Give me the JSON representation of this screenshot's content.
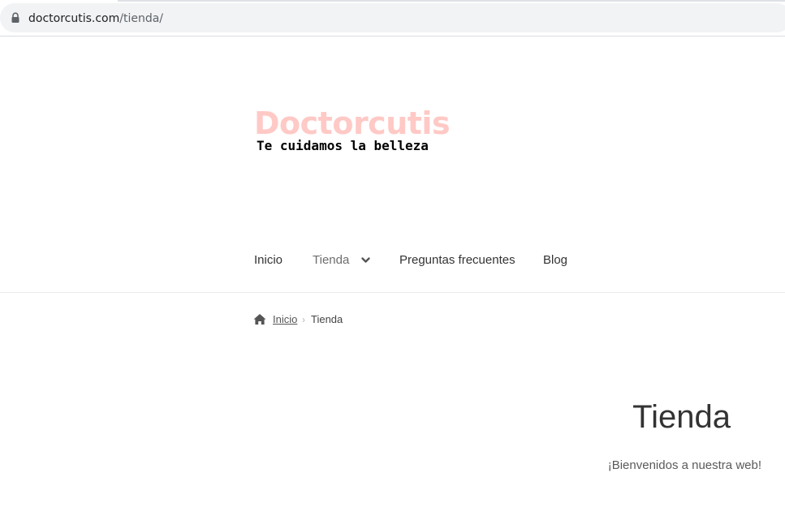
{
  "browser": {
    "url_domain": "doctorcutis.com",
    "url_path": "/tienda/"
  },
  "site": {
    "logo_title": "Doctorcutis",
    "logo_tagline": "Te cuidamos la belleza"
  },
  "nav": {
    "items": [
      {
        "label": "Inicio"
      },
      {
        "label": "Tienda"
      },
      {
        "label": "Preguntas frecuentes"
      },
      {
        "label": "Blog"
      }
    ],
    "current": "Tienda"
  },
  "breadcrumb": {
    "home_label": "Inicio",
    "separator": "›",
    "current": "Tienda"
  },
  "page": {
    "title": "Tienda",
    "intro": "¡Bienvenidos a nuestra web!"
  },
  "colors": {
    "logo_title": "#ffc9c6",
    "logo_tagline": "#000000",
    "text": "#333333",
    "address_bar": "#f1f3f4"
  },
  "icons": {
    "address_bar": "lock-icon",
    "nav_dropdown": "chevron-down-icon",
    "breadcrumb_home": "home-icon"
  }
}
